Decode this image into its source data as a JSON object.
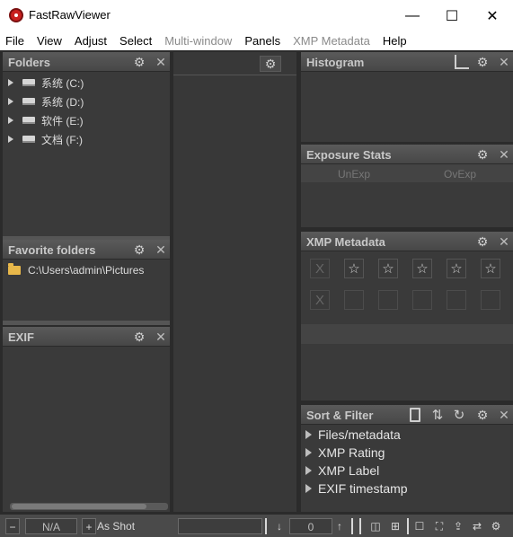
{
  "app": {
    "title": "FastRawViewer"
  },
  "window_controls": {
    "minimize": "—",
    "maximize": "☐",
    "close": "✕"
  },
  "menu": [
    "File",
    "View",
    "Adjust",
    "Select",
    "Multi-window",
    "Panels",
    "XMP Metadata",
    "Help"
  ],
  "menu_disabled": [
    4,
    6
  ],
  "folders_panel": {
    "title": "Folders",
    "drives": [
      "系统 (C:)",
      "系统 (D:)",
      "软件 (E:)",
      "文档 (F:)"
    ]
  },
  "favorites_panel": {
    "title": "Favorite folders",
    "items": [
      "C:\\Users\\admin\\Pictures"
    ]
  },
  "exif_panel": {
    "title": "EXIF"
  },
  "histogram_panel": {
    "title": "Histogram"
  },
  "exposure_panel": {
    "title": "Exposure Stats",
    "col_under": "UnExp",
    "col_over": "OvExp"
  },
  "xmp_panel": {
    "title": "XMP Metadata",
    "rating_row": [
      "X",
      "☆",
      "☆",
      "☆",
      "☆",
      "☆"
    ],
    "label_row": [
      "X",
      "",
      "",
      "",
      "",
      ""
    ]
  },
  "sort_panel": {
    "title": "Sort & Filter",
    "items": [
      "Files/metadata",
      "XMP Rating",
      "XMP Label",
      "EXIF timestamp"
    ]
  },
  "toolbar": {
    "minus": "−",
    "zoom_value": "N/A",
    "plus": "+",
    "wb_mode": "As Shot",
    "exposure_value": "0"
  },
  "icons": {
    "gear": "⚙",
    "close": "✕"
  },
  "colors": {
    "panel_bg": "#3a3a3a",
    "header_bg": "#4f4f4f",
    "header_text": "#c8c8c8",
    "folder_yellow": "#e8b84a",
    "app_red": "#c9201f"
  }
}
